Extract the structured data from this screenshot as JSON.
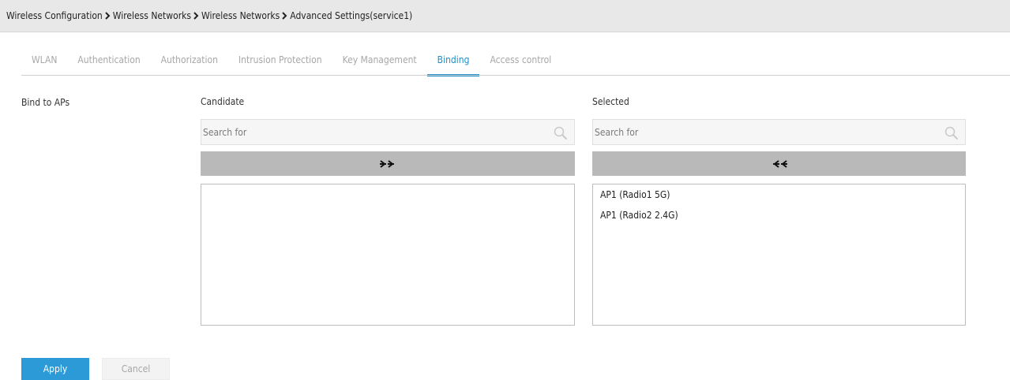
{
  "breadcrumb": [
    "Wireless Configuration",
    "Wireless Networks",
    "Wireless Networks",
    "Advanced Settings(service1)"
  ],
  "tabs": [
    {
      "label": "WLAN",
      "active": false
    },
    {
      "label": "Authentication",
      "active": false
    },
    {
      "label": "Authorization",
      "active": false
    },
    {
      "label": "Intrusion Protection",
      "active": false
    },
    {
      "label": "Key Management",
      "active": false
    },
    {
      "label": "Binding",
      "active": true
    },
    {
      "label": "Access control",
      "active": false
    }
  ],
  "bind": {
    "label": "Bind to APs",
    "candidate": {
      "title": "Candidate",
      "search_placeholder": "Search for",
      "move_button_icon": "double-arrow-right-icon",
      "items": []
    },
    "selected": {
      "title": "Selected",
      "search_placeholder": "Search for",
      "move_button_icon": "double-arrow-left-icon",
      "items": [
        "AP1 (Radio1 5G)",
        "AP1 (Radio2 2.4G)"
      ]
    }
  },
  "actions": {
    "apply": "Apply",
    "cancel": "Cancel"
  },
  "colors": {
    "accent": "#1f8fc8",
    "apply_bg": "#2b9ad6",
    "move_bg": "#b9b9b9"
  }
}
